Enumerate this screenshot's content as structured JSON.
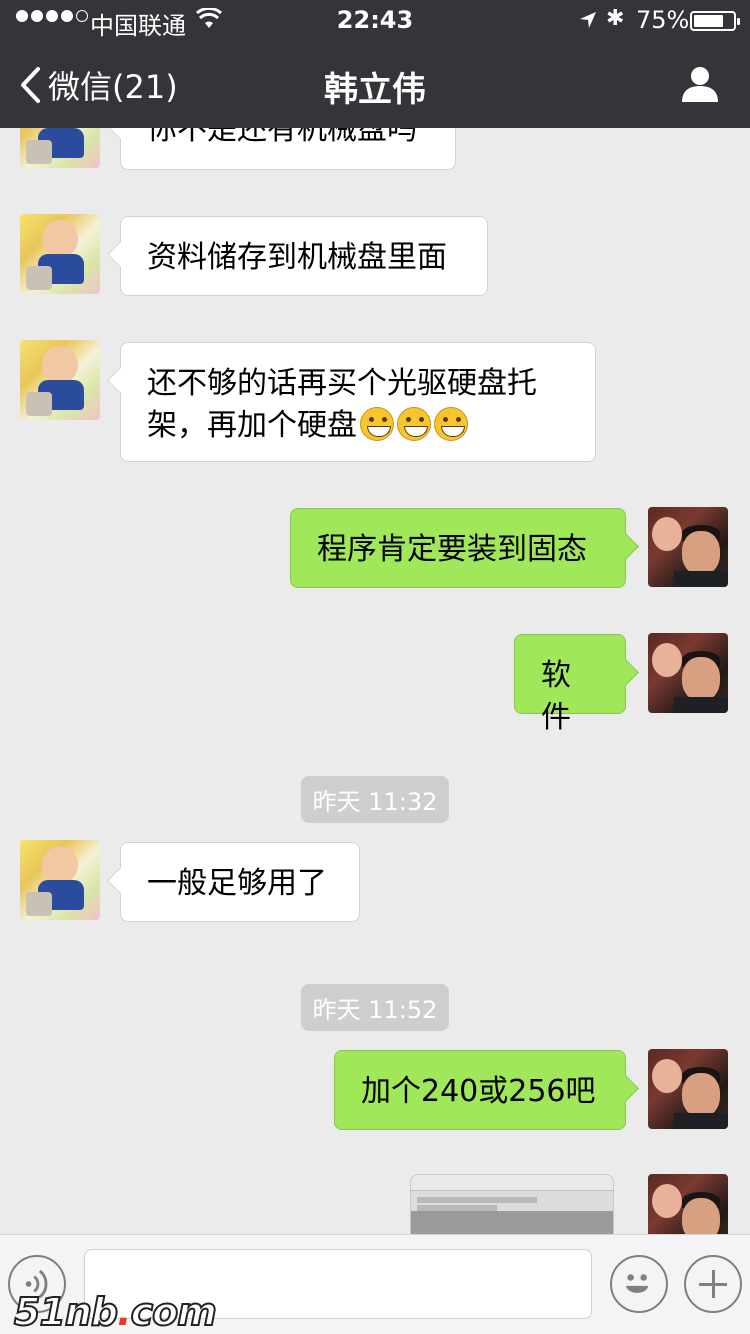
{
  "status_bar": {
    "carrier": "中国联通",
    "time": "22:43",
    "battery_pct_text": "75%",
    "battery_level": 0.75
  },
  "nav": {
    "back_label": "微信(21)",
    "title": "韩立伟"
  },
  "messages": [
    {
      "side": "left",
      "text": "你不是还有机械盘吗"
    },
    {
      "side": "left",
      "text": "资料储存到机械盘里面"
    },
    {
      "side": "left",
      "text": "还不够的话再买个光驱硬盘托",
      "text2": "架，再加个硬盘",
      "emoji_count": 3
    },
    {
      "side": "right",
      "text": "程序肯定要装到固态"
    },
    {
      "side": "right",
      "text": "软件"
    },
    {
      "side": "right",
      "text": "加个240或256吧"
    }
  ],
  "timestamps": [
    "昨天 11:32",
    "昨天 11:52"
  ],
  "left_late": {
    "text": "一般足够用了"
  },
  "image_message": {
    "icon": "screenshot-thumbnail"
  },
  "input_bar": {
    "voice_icon": "voice-icon",
    "emoji_icon": "emoji-icon",
    "plus_icon": "plus-icon"
  },
  "watermark": {
    "main": "51nb",
    "dot": ".",
    "tld": "com"
  },
  "colors": {
    "nav_bg": "#333538",
    "chat_bg": "#ebebeb",
    "bubble_right": "#a0e75a",
    "bubble_left": "#ffffff",
    "timestamp_bg": "#cecece"
  }
}
